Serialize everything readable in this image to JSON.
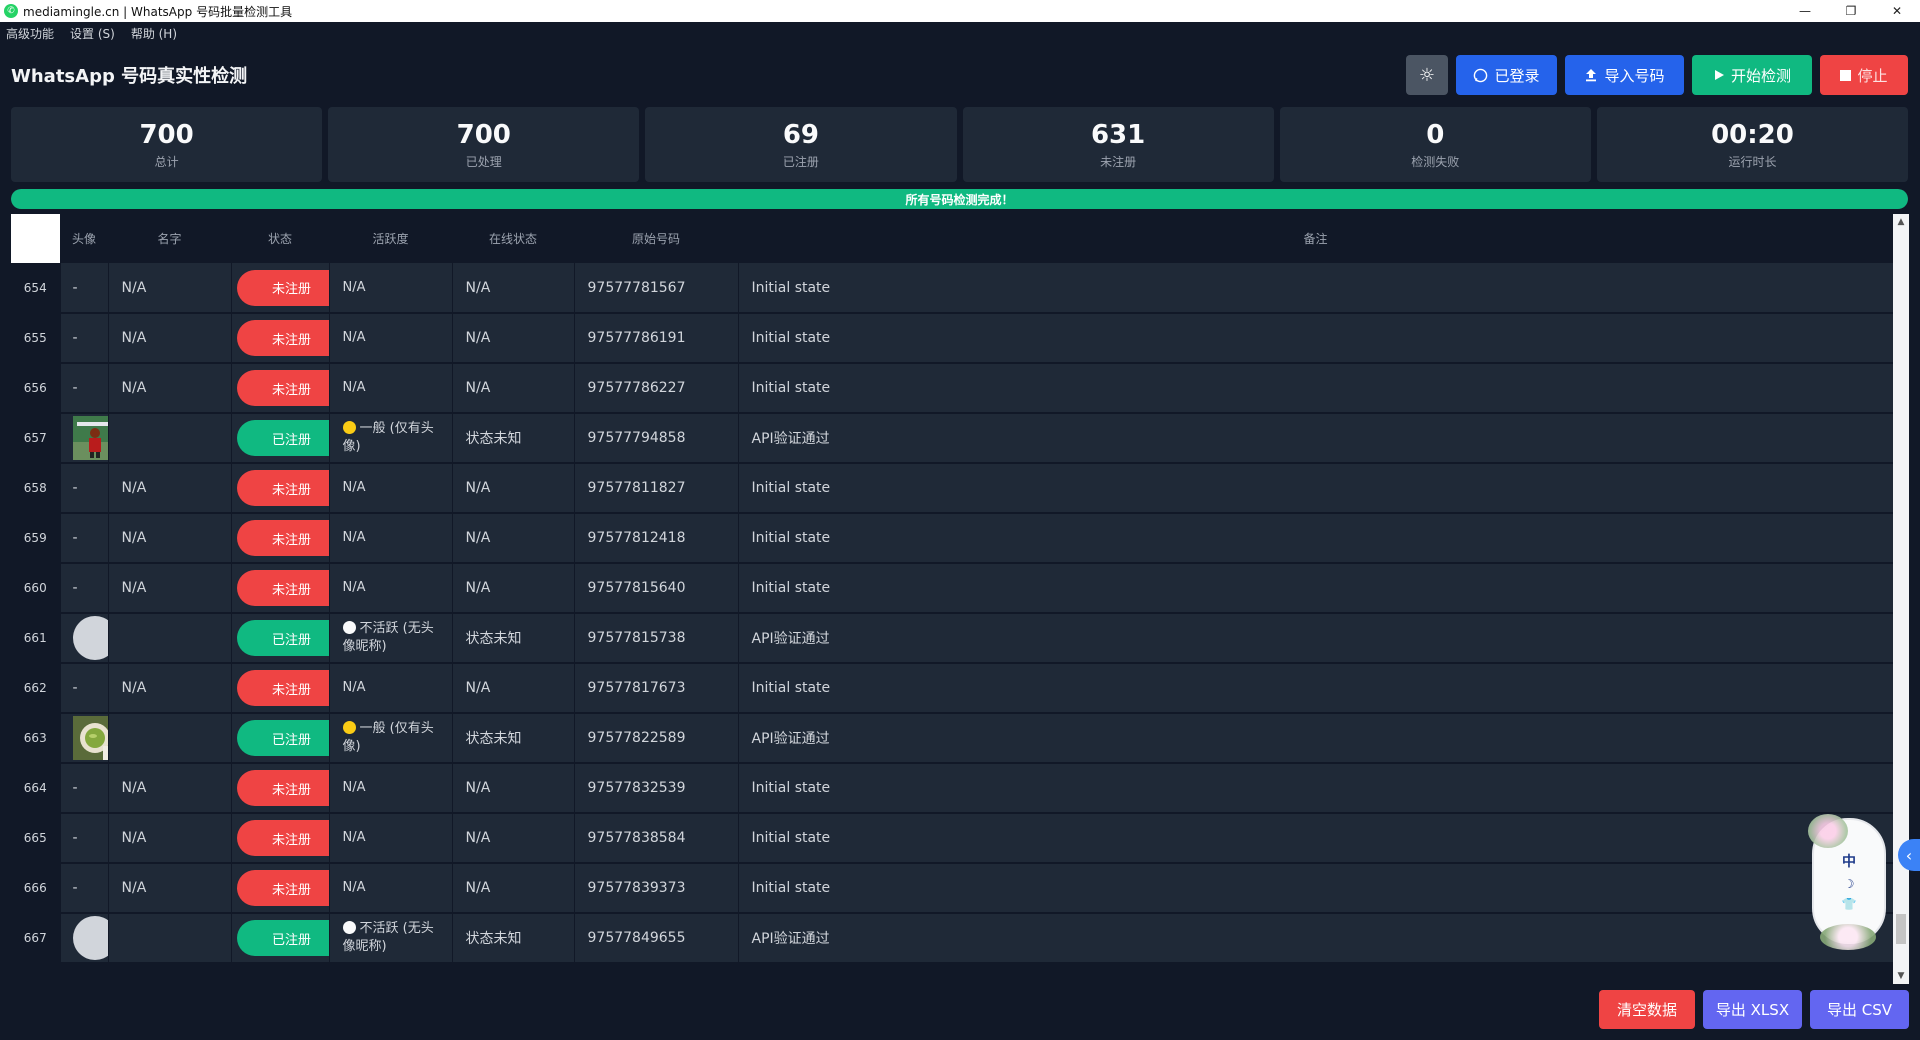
{
  "window": {
    "title": "mediamingle.cn | WhatsApp 号码批量检测工具",
    "controls": [
      "—",
      "❐",
      "✕"
    ]
  },
  "menu": [
    "高级功能",
    "设置 (S)",
    "帮助 (H)"
  ],
  "header": {
    "title": "WhatsApp 号码真实性检测",
    "theme_icon": "☼",
    "login_label": "已登录",
    "import_label": "导入号码",
    "start_label": "开始检测",
    "stop_label": "停止"
  },
  "stats": [
    {
      "value": "700",
      "label": "总计"
    },
    {
      "value": "700",
      "label": "已处理"
    },
    {
      "value": "69",
      "label": "已注册"
    },
    {
      "value": "631",
      "label": "未注册"
    },
    {
      "value": "0",
      "label": "检测失败"
    },
    {
      "value": "00:20",
      "label": "运行时长"
    }
  ],
  "progress": {
    "percent": 100,
    "text": "所有号码检测完成！"
  },
  "table": {
    "columns": [
      "头像",
      "名字",
      "状态",
      "活跃度",
      "在线状态",
      "原始号码",
      "备注"
    ],
    "rows": [
      {
        "num": "654",
        "avatar": "-",
        "avatar_type": "dash",
        "name": "N/A",
        "status": "未注册",
        "registered": false,
        "activity": "N/A",
        "activity_dot": "",
        "online": "N/A",
        "phone": "97577781567",
        "note": "Initial state"
      },
      {
        "num": "655",
        "avatar": "-",
        "avatar_type": "dash",
        "name": "N/A",
        "status": "未注册",
        "registered": false,
        "activity": "N/A",
        "activity_dot": "",
        "online": "N/A",
        "phone": "97577786191",
        "note": "Initial state"
      },
      {
        "num": "656",
        "avatar": "-",
        "avatar_type": "dash",
        "name": "N/A",
        "status": "未注册",
        "registered": false,
        "activity": "N/A",
        "activity_dot": "",
        "online": "N/A",
        "phone": "97577786227",
        "note": "Initial state"
      },
      {
        "num": "657",
        "avatar": "",
        "avatar_type": "photo-a",
        "name": "",
        "status": "已注册",
        "registered": true,
        "activity": "一般 (仅有头像)",
        "activity_dot": "yellow",
        "online": "状态未知",
        "phone": "97577794858",
        "note": "API验证通过"
      },
      {
        "num": "658",
        "avatar": "-",
        "avatar_type": "dash",
        "name": "N/A",
        "status": "未注册",
        "registered": false,
        "activity": "N/A",
        "activity_dot": "",
        "online": "N/A",
        "phone": "97577811827",
        "note": "Initial state"
      },
      {
        "num": "659",
        "avatar": "-",
        "avatar_type": "dash",
        "name": "N/A",
        "status": "未注册",
        "registered": false,
        "activity": "N/A",
        "activity_dot": "",
        "online": "N/A",
        "phone": "97577812418",
        "note": "Initial state"
      },
      {
        "num": "660",
        "avatar": "-",
        "avatar_type": "dash",
        "name": "N/A",
        "status": "未注册",
        "registered": false,
        "activity": "N/A",
        "activity_dot": "",
        "online": "N/A",
        "phone": "97577815640",
        "note": "Initial state"
      },
      {
        "num": "661",
        "avatar": "",
        "avatar_type": "circle",
        "name": "",
        "status": "已注册",
        "registered": true,
        "activity": "不活跃 (无头像昵称)",
        "activity_dot": "white",
        "online": "状态未知",
        "phone": "97577815738",
        "note": "API验证通过"
      },
      {
        "num": "662",
        "avatar": "-",
        "avatar_type": "dash",
        "name": "N/A",
        "status": "未注册",
        "registered": false,
        "activity": "N/A",
        "activity_dot": "",
        "online": "N/A",
        "phone": "97577817673",
        "note": "Initial state"
      },
      {
        "num": "663",
        "avatar": "",
        "avatar_type": "photo-b",
        "name": "",
        "status": "已注册",
        "registered": true,
        "activity": "一般 (仅有头像)",
        "activity_dot": "yellow",
        "online": "状态未知",
        "phone": "97577822589",
        "note": "API验证通过"
      },
      {
        "num": "664",
        "avatar": "-",
        "avatar_type": "dash",
        "name": "N/A",
        "status": "未注册",
        "registered": false,
        "activity": "N/A",
        "activity_dot": "",
        "online": "N/A",
        "phone": "97577832539",
        "note": "Initial state"
      },
      {
        "num": "665",
        "avatar": "-",
        "avatar_type": "dash",
        "name": "N/A",
        "status": "未注册",
        "registered": false,
        "activity": "N/A",
        "activity_dot": "",
        "online": "N/A",
        "phone": "97577838584",
        "note": "Initial state"
      },
      {
        "num": "666",
        "avatar": "-",
        "avatar_type": "dash",
        "name": "N/A",
        "status": "未注册",
        "registered": false,
        "activity": "N/A",
        "activity_dot": "",
        "online": "N/A",
        "phone": "97577839373",
        "note": "Initial state"
      },
      {
        "num": "667",
        "avatar": "",
        "avatar_type": "circle",
        "name": "",
        "status": "已注册",
        "registered": true,
        "activity": "不活跃 (无头像昵称)",
        "activity_dot": "white",
        "online": "状态未知",
        "phone": "97577849655",
        "note": "API验证通过"
      }
    ]
  },
  "floating_widget": {
    "label": "中",
    "icons": [
      "moon-icon",
      "shirt-icon"
    ],
    "moon": "☽",
    "shirt": "👕",
    "collapse": "‹"
  },
  "footer": {
    "clear_label": "清空数据",
    "xlsx_label": "导出 XLSX",
    "csv_label": "导出 CSV"
  },
  "colors": {
    "unregistered": "#ef4444",
    "registered": "#10b981",
    "primary": "#2563eb",
    "export": "#6366f1"
  }
}
